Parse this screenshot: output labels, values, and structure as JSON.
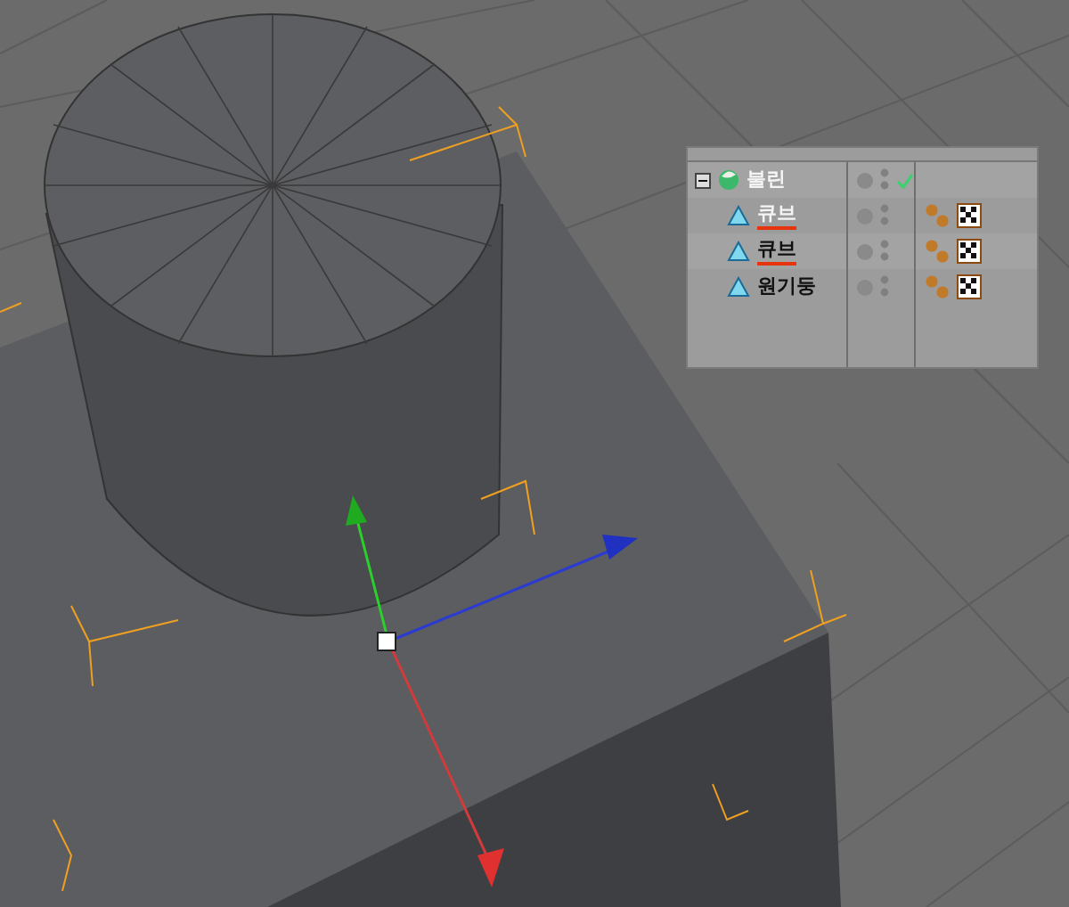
{
  "object_manager": {
    "root": {
      "label": "불린",
      "expanded": true,
      "selected": true,
      "checked": true,
      "children": [
        {
          "label": "큐브",
          "selected": true,
          "underlined": true
        },
        {
          "label": "큐브",
          "selected": false,
          "underlined": true
        },
        {
          "label": "원기둥",
          "selected": false,
          "underlined": false
        }
      ]
    }
  }
}
